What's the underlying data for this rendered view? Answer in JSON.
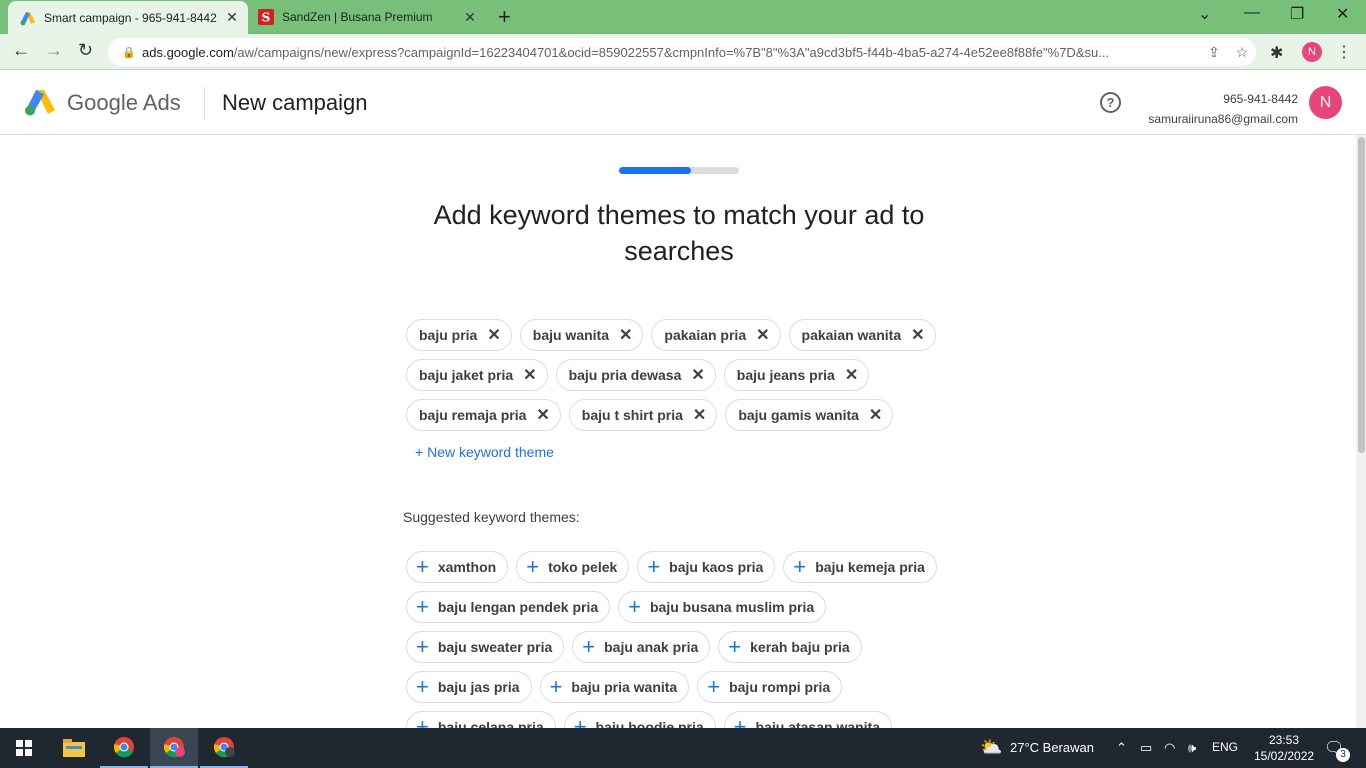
{
  "browser": {
    "tabs": [
      {
        "title": "Smart campaign - 965-941-8442",
        "active": true
      },
      {
        "title": "SandZen | Busana Premium",
        "active": false
      }
    ],
    "new_tab_glyph": "+",
    "url_host": "ads.google.com",
    "url_path": "/aw/campaigns/new/express?campaignId=16223404701&ocid=859022557&cmpnInfo=%7B\"8\"%3A\"a9cd3bf5-f44b-4ba5-a274-4e52ee8f88fe\"%7D&su...",
    "profile_initial": "N"
  },
  "header": {
    "brand_google": "Google",
    "brand_ads": "Ads",
    "page_title": "New campaign",
    "account_id": "965-941-8442",
    "account_email": "samuraiiruna86@gmail.com",
    "avatar_initial": "N"
  },
  "main": {
    "progress": 0.6,
    "heading": "Add keyword themes to match your ad to searches",
    "keyword_themes": [
      "baju pria",
      "baju wanita",
      "pakaian pria",
      "pakaian wanita",
      "baju jaket pria",
      "baju pria dewasa",
      "baju jeans pria",
      "baju remaja pria",
      "baju t shirt pria",
      "baju gamis wanita"
    ],
    "new_keyword_label": "+ New keyword theme",
    "suggested_label": "Suggested keyword themes:",
    "suggested": [
      "xamthon",
      "toko pelek",
      "baju kaos pria",
      "baju kemeja pria",
      "baju lengan pendek pria",
      "baju busana muslim pria",
      "baju sweater pria",
      "baju anak pria",
      "kerah baju pria",
      "baju jas pria",
      "baju pria wanita",
      "baju rompi pria",
      "baju celana pria",
      "baju hoodie pria",
      "baju atasan wanita"
    ]
  },
  "taskbar": {
    "weather": "27°C  Berawan",
    "lang": "ENG",
    "time": "23:53",
    "date": "15/02/2022",
    "notif_count": "3"
  },
  "colors": {
    "accent": "#1a73e8",
    "tabbar": "#78c07a",
    "avatar": "#e8457a"
  }
}
